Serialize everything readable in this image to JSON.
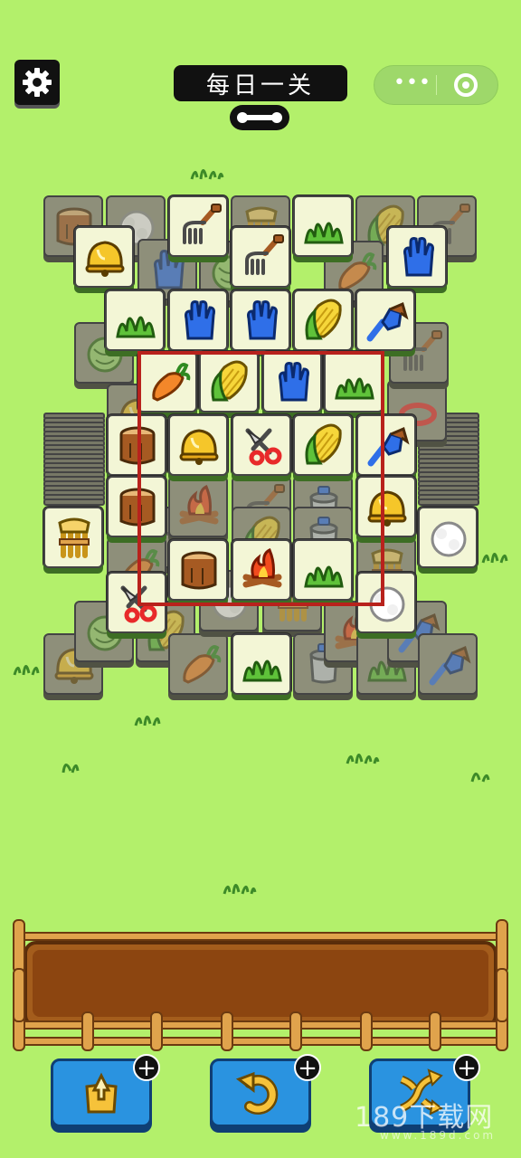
{
  "header": {
    "title": "每日一关",
    "capsule_more": "•••"
  },
  "tools": [
    {
      "name": "move-out",
      "plus": "+"
    },
    {
      "name": "undo",
      "plus": "+"
    },
    {
      "name": "shuffle",
      "plus": "+"
    }
  ],
  "watermark": {
    "main": "189下载网",
    "sub": "www.189d.com"
  },
  "colors": {
    "background": "#b3f06b",
    "highlight_box": "#b8221c",
    "tool_button": "#2a93e0"
  }
}
